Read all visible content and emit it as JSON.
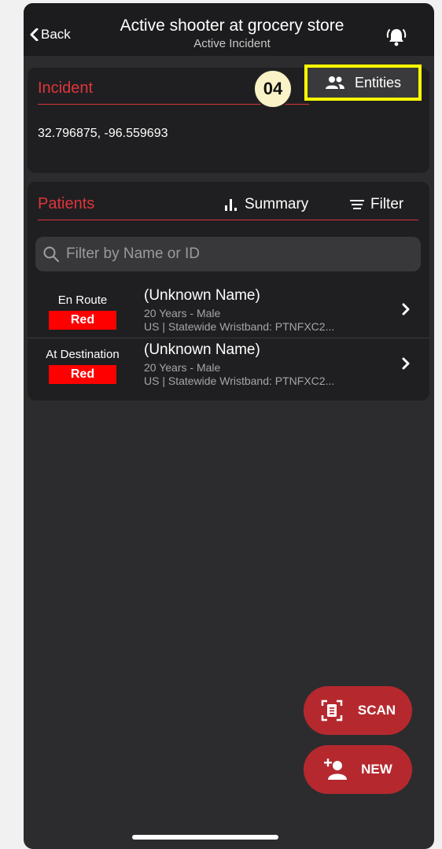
{
  "nav": {
    "back_label": "Back",
    "title": "Active shooter at grocery store",
    "subtitle": "Active Incident"
  },
  "incident": {
    "section_title": "Incident",
    "callout_number": "04",
    "entities_label": "Entities",
    "coordinates": "32.796875, -96.559693"
  },
  "patients": {
    "section_title": "Patients",
    "summary_label": "Summary",
    "filter_label": "Filter",
    "search_placeholder": "Filter by Name or ID",
    "search_value": "",
    "rows": [
      {
        "status": "En Route",
        "triage": "Red",
        "name": "(Unknown Name)",
        "info": "20 Years - Male",
        "id_line": "US | Statewide Wristband: PTNFXC2..."
      },
      {
        "status": "At Destination",
        "triage": "Red",
        "name": "(Unknown Name)",
        "info": "20 Years - Male",
        "id_line": "US | Statewide Wristband: PTNFXC2..."
      }
    ]
  },
  "actions": {
    "scan_label": "SCAN",
    "new_label": "NEW"
  },
  "icons": {
    "back": "chevron-left-icon",
    "alert": "bell-alert-icon",
    "entities": "people-icon",
    "summary": "bar-chart-icon",
    "filter": "filter-lines-icon",
    "search": "search-icon",
    "row_chevron": "chevron-right-icon",
    "scan": "scan-id-icon",
    "new": "add-person-icon"
  },
  "colors": {
    "accent_red": "#e0343b",
    "triage_red": "#ff0000",
    "fab_red": "#b5292e",
    "highlight_yellow": "#ffff00",
    "callout_fill": "#fbf3c8"
  }
}
